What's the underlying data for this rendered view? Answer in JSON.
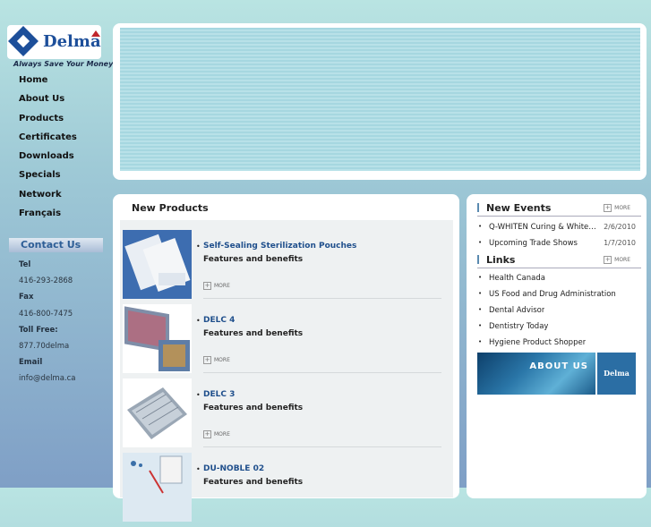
{
  "logo": {
    "text": "Delma",
    "tagline": "Always Save Your Money"
  },
  "nav": [
    "Home",
    "About Us",
    "Products",
    "Certificates",
    "Downloads",
    "Specials",
    "Network",
    "Français"
  ],
  "contact": {
    "title": "Contact Us",
    "tel_label": "Tel",
    "tel": "416-293-2868",
    "fax_label": "Fax",
    "fax": "416-800-7475",
    "tollfree_label": "Toll Free:",
    "tollfree": "877.70delma",
    "email_label": "Email",
    "email": "info@delma.ca"
  },
  "new_products": {
    "title": "New Products",
    "more_label": "MORE",
    "items": [
      {
        "name": "Self-Sealing Sterilization Pouches",
        "desc": "Features and benefits"
      },
      {
        "name": "DELC 4",
        "desc": "Features and benefits"
      },
      {
        "name": "DELC 3",
        "desc": "Features and benefits"
      },
      {
        "name": "DU-NOBLE 02",
        "desc": "Features and benefits"
      }
    ]
  },
  "events": {
    "title": "New Events",
    "more_label": "MORE",
    "items": [
      {
        "text": "Q-WHITEN Curing & Whitening...",
        "date": "2/6/2010"
      },
      {
        "text": "Upcoming Trade Shows",
        "date": "1/7/2010"
      }
    ]
  },
  "links": {
    "title": "Links",
    "more_label": "MORE",
    "items": [
      "Health Canada",
      "US Food and Drug Administration",
      "Dental Advisor",
      "Dentistry Today",
      "Hygiene Product Shopper"
    ]
  },
  "about_banner": {
    "text": "ABOUT US",
    "logo": "Delma"
  }
}
